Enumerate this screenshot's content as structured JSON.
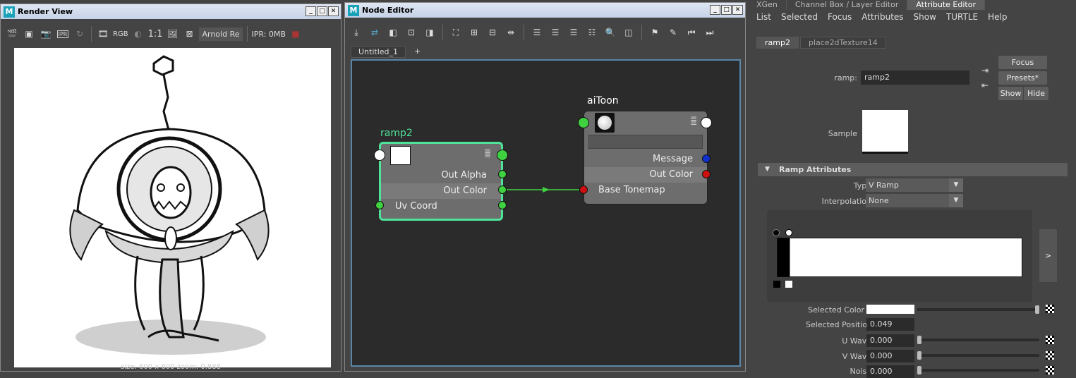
{
  "render_view": {
    "title": "Render View",
    "toolbar": {
      "rgb_label": "RGB",
      "zoom_label": "1:1",
      "renderer_label": "Arnold Re",
      "ipr_memory": "IPR: 0MB"
    },
    "status": "size: 600 x 600  zoom: 0.888"
  },
  "node_editor": {
    "title": "Node Editor",
    "tab_label": "Untitled_1",
    "add_tab_label": "+",
    "nodes": {
      "ramp": {
        "name": "ramp2",
        "ports": [
          "Out Alpha",
          "Out Color",
          "Uv Coord"
        ]
      },
      "aitoon": {
        "name": "aiToon",
        "ports": [
          "Message",
          "Out Color",
          "Base Tonemap"
        ]
      }
    }
  },
  "attribute_editor": {
    "tabs": [
      "XGen",
      "Channel Box / Layer Editor",
      "Attribute Editor"
    ],
    "menu": [
      "List",
      "Selected",
      "Focus",
      "Attributes",
      "Show",
      "TURTLE",
      "Help"
    ],
    "node_tabs": [
      "ramp2",
      "place2dTexture14"
    ],
    "ramp_label": "ramp:",
    "ramp_value": "ramp2",
    "buttons": {
      "focus": "Focus",
      "presets": "Presets*",
      "show": "Show",
      "hide": "Hide"
    },
    "sample_label": "Sample",
    "section_title": "Ramp Attributes",
    "type_label": "Type",
    "type_value": "V Ramp",
    "interpolation_label": "Interpolation",
    "interpolation_value": "None",
    "expand_label": ">",
    "selected_color_label": "Selected Color",
    "selected_position_label": "Selected Position",
    "selected_position_value": "0.049",
    "u_wave_label": "U Wave",
    "u_wave_value": "0.000",
    "v_wave_label": "V Wave",
    "v_wave_value": "0.000",
    "noise_label": "Noise",
    "noise_value": "0.000"
  },
  "colors": {
    "ramp_selected": "#4fe39a",
    "port_green": "#3fd13f",
    "port_red": "#d01010",
    "port_blue": "#1030d0",
    "graph_bg": "#2b2b2b"
  }
}
